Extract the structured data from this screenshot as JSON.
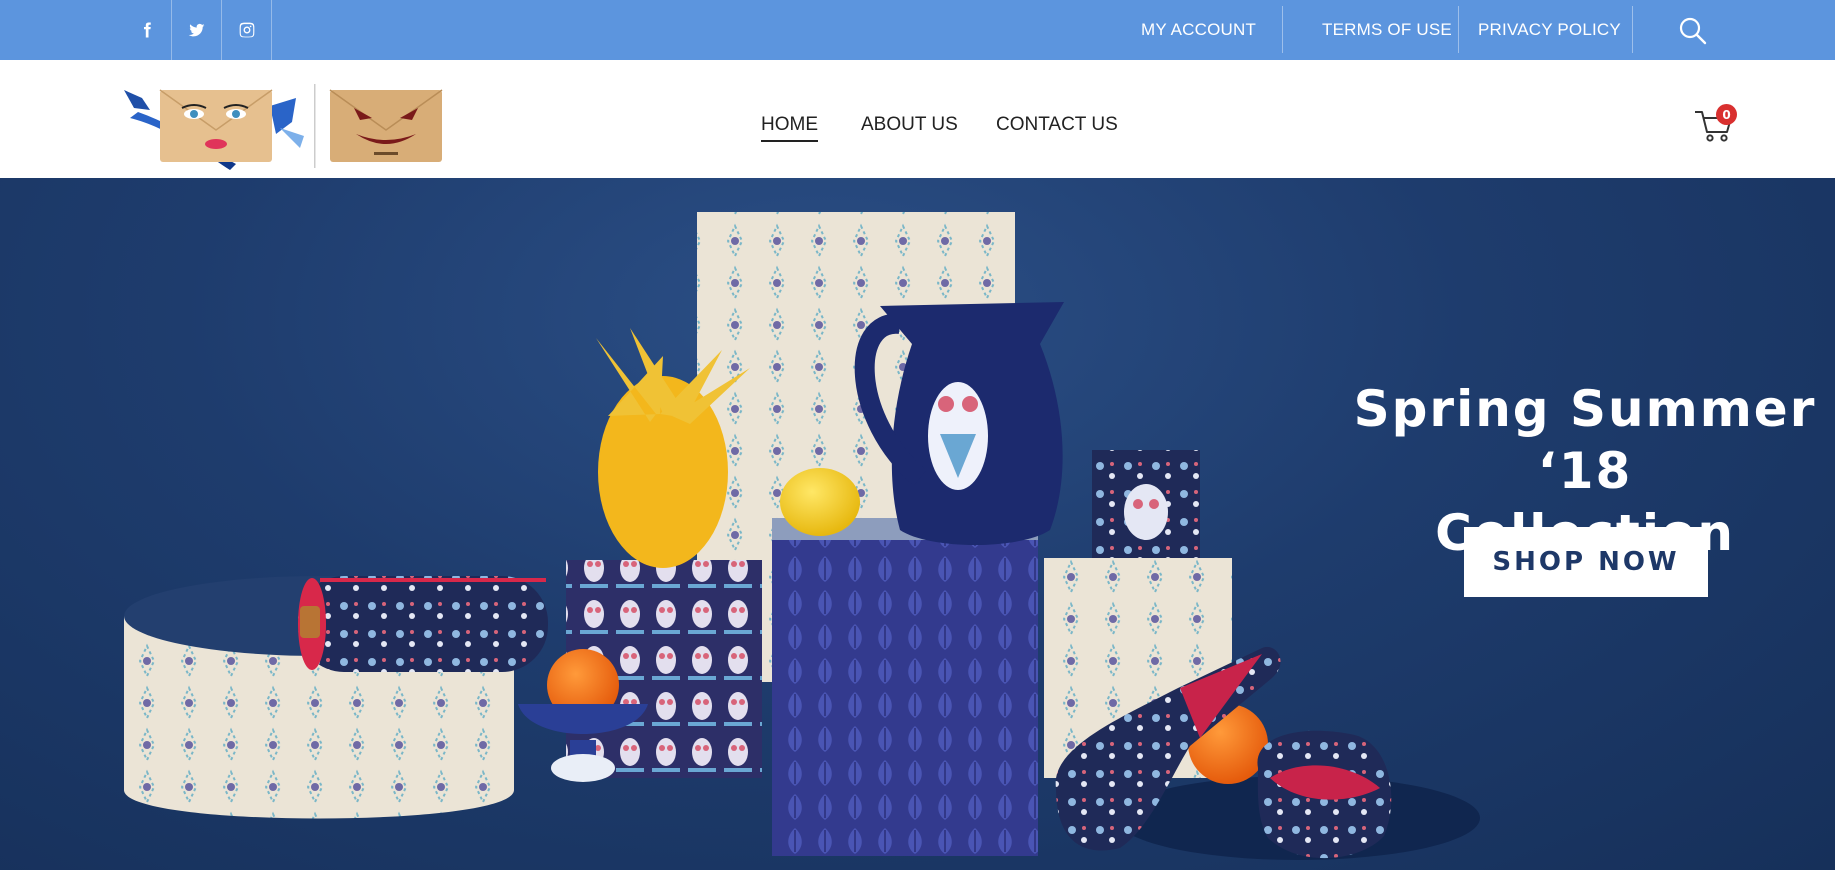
{
  "topbar": {
    "social": [
      {
        "icon": "facebook-icon"
      },
      {
        "icon": "twitter-icon"
      },
      {
        "icon": "instagram-icon"
      }
    ],
    "links": {
      "my_account": "MY ACCOUNT",
      "terms": "TERMS OF USE",
      "privacy": "PRIVACY POLICY"
    },
    "search_icon": "search-icon",
    "bg_color": "#5c95de"
  },
  "header": {
    "nav": {
      "home": "HOME",
      "about": "ABOUT US",
      "contact": "CONTACT US"
    },
    "active_nav": "HOME",
    "cart_count": "0",
    "cart_icon": "cart-icon"
  },
  "hero": {
    "title_line1": "Spring Summer ‘18",
    "title_line2": "Collection",
    "cta_label": "SHOP NOW",
    "bg_color": "#1e3c6d"
  }
}
